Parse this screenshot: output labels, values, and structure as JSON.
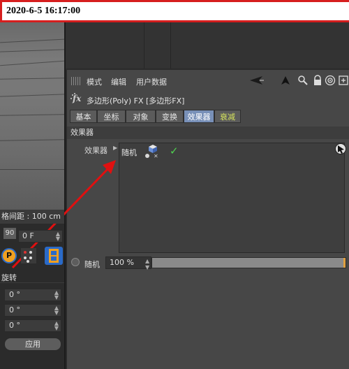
{
  "banner": {
    "timestamp": "2020-6-5 16:17:00"
  },
  "menu": {
    "items": [
      "模式",
      "编辑",
      "用户数据"
    ],
    "tool_icons": [
      "back-arrow-icon",
      "up-arrow-icon",
      "search-icon",
      "lock-icon",
      "target-icon",
      "new-panel-icon"
    ]
  },
  "object": {
    "title": "多边形(Poly) FX [多边形FX]"
  },
  "tabs": [
    {
      "label": "基本"
    },
    {
      "label": "坐标"
    },
    {
      "label": "对象"
    },
    {
      "label": "变换"
    },
    {
      "label": "效果器"
    },
    {
      "label": "衰减"
    }
  ],
  "active_tab": "效果器",
  "section": {
    "title": "效果器"
  },
  "effectors": {
    "label": "效果器",
    "items": [
      {
        "name": "随机",
        "icon": "random-effector-icon",
        "enabled": true
      }
    ]
  },
  "random": {
    "label": "随机",
    "value": "100 %",
    "fraction": 1.0
  },
  "left_panel": {
    "grid_distance": "格间距 : 100 cm",
    "frame_small": "90",
    "frame_value": "0 F",
    "p_button": "P",
    "rotation_title": "旋转",
    "rotation_values": [
      "0 °",
      "0 °",
      "0 °"
    ],
    "apply_label": "应用"
  },
  "colors": {
    "banner_border": "#d61e1e",
    "active_tab": "#7890b8",
    "decay_tab_text": "#d6e35c",
    "check": "#4fd14f",
    "arrow": "#e01010",
    "slider_knob": "#e0a040"
  }
}
